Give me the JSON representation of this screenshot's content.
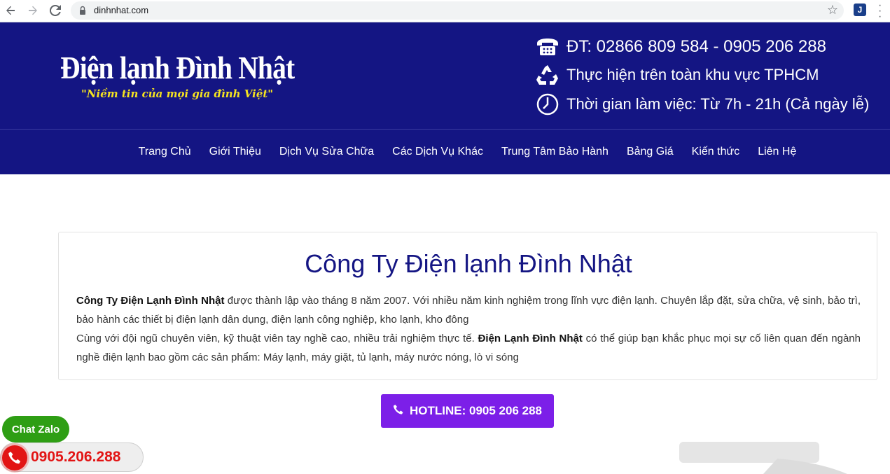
{
  "browser": {
    "url": "dinhnhat.com",
    "icons": [
      "back-arrow-icon",
      "forward-arrow-icon",
      "reload-icon",
      "lock-icon",
      "star-icon",
      "extension-icon",
      "menu-icon"
    ]
  },
  "header": {
    "logo_title": "Điện lạnh Đình Nhật",
    "logo_slogan": "\"Niềm tin của mọi gia đình Việt\"",
    "phone_line": "ĐT: 02866 809 584 - 0905 206 288",
    "area_line": "Thực hiện trên toàn khu vực TPHCM",
    "hours_line": "Thời gian làm việc: Từ 7h - 21h (Cả ngày lễ)",
    "background": "#141583"
  },
  "nav": {
    "items": [
      {
        "label": "Trang Chủ"
      },
      {
        "label": "Giới Thiệu"
      },
      {
        "label": "Dịch Vụ Sửa Chữa"
      },
      {
        "label": "Các Dịch Vụ Khác"
      },
      {
        "label": "Trung Tâm Bảo Hành"
      },
      {
        "label": "Bảng Giá"
      },
      {
        "label": "Kiến thức"
      },
      {
        "label": "Liên Hệ"
      }
    ]
  },
  "main": {
    "title": "Công Ty Điện lạnh Đình Nhật",
    "p1_bold": "Công Ty Điện Lạnh Đình Nhật",
    "p1_rest": " được thành lập vào tháng 8 năm 2007. Với nhiều năm kinh nghiệm trong lĩnh vực điện lạnh. Chuyên lắp đặt, sửa chữa, vệ sinh, bảo trì, bảo hành các thiết bị điện lạnh dân dụng, điện lạnh công nghiệp, kho lạnh, kho đông",
    "p2_start": "Cùng với đội ngũ chuyên viên, kỹ thuật viên tay nghề cao, nhiều trải nghiệm thực tế. ",
    "p2_bold": "Điện Lạnh Đình Nhật",
    "p2_rest": " có thể giúp bạn khắc phục mọi sự cố liên quan đến ngành nghề điện lạnh bao gồm các sản phẩm: Máy lạnh, máy giặt, tủ lạnh, máy nước nóng, lò vi sóng",
    "hotline_button": "HOTLINE: 0905 206 288",
    "hotline_color": "#7c1fe8"
  },
  "floating": {
    "zalo_label": "Chat Zalo",
    "phone_number": "0905.206.288",
    "zalo_color": "#2e9e14",
    "phone_color": "#e21414"
  }
}
